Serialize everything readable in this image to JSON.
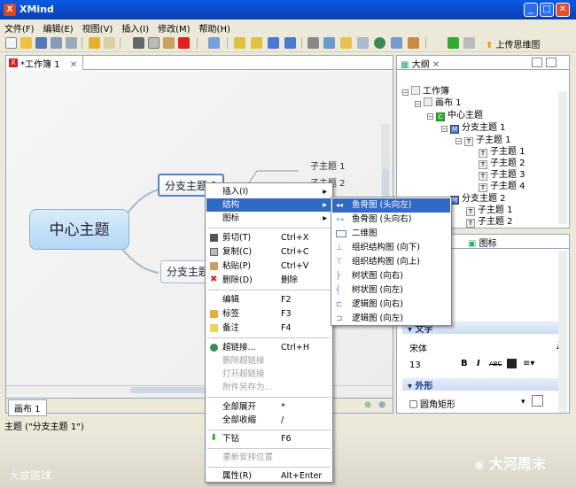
{
  "app": {
    "title": "XMind",
    "logo": "X"
  },
  "menubar": [
    "文件(F)",
    "编辑(E)",
    "视图(V)",
    "插入(I)",
    "修改(M)",
    "帮助(H)"
  ],
  "toolbar": {
    "upload_label": "上传思维图"
  },
  "editor": {
    "tab_label": "*工作簿 1",
    "central_topic": "中心主题",
    "branch1": "分支主题 1",
    "branch2": "分支主题 2",
    "subtopics": [
      "子主题 1",
      "子主题 2"
    ],
    "sheet_tab": "画布 1"
  },
  "outline": {
    "title": "大纲",
    "rows": [
      "工作簿",
      "画布 1",
      "中心主题",
      "分支主题 1",
      "子主题 1",
      "子主题 1",
      "子主题 2",
      "子主题 3",
      "子主题 4",
      "分支主题 2",
      "子主题 1",
      "子主题 2"
    ]
  },
  "props": {
    "tab_label": "图标",
    "text_section": "文字",
    "font_name": "宋体",
    "font_size": "13",
    "shape_section": "外形",
    "shape_value": "圆角矩形"
  },
  "context_menu": {
    "insert": "插入(I)",
    "structure": "结构",
    "icon": "图标",
    "cut": "剪切(T)",
    "cut_sc": "Ctrl+X",
    "copy": "复制(C)",
    "copy_sc": "Ctrl+C",
    "paste": "粘贴(P)",
    "paste_sc": "Ctrl+V",
    "delete": "删除(D)",
    "delete_sc": "删除",
    "edit": "编辑",
    "edit_sc": "F2",
    "label": "标签",
    "label_sc": "F3",
    "note": "备注",
    "note_sc": "F4",
    "hyperlink": "超链接...",
    "hyperlink_sc": "Ctrl+H",
    "remove_link": "删除超链接",
    "open_link": "打开超链接",
    "save_attachment": "附件另存为...",
    "expand_all": "全部展开",
    "expand_sc": "*",
    "collapse_all": "全部收缩",
    "collapse_sc": "/",
    "drill_down": "下钻",
    "drill_sc": "F6",
    "reset_position": "重新安排位置",
    "properties": "属性(R)",
    "properties_sc": "Alt+Enter"
  },
  "structure_submenu": [
    "鱼骨图 (头向左)",
    "鱼骨图 (头向右)",
    "二维图",
    "组织结构图 (向下)",
    "组织结构图 (向上)",
    "树状图 (向右)",
    "树状图 (向左)",
    "逻辑图 (向右)",
    "逻辑图 (向左)"
  ],
  "statusbar": {
    "text": "主题 (\"分支主题 1\")"
  },
  "watermarks": {
    "left": "大故路球",
    "right": "大河周末"
  }
}
